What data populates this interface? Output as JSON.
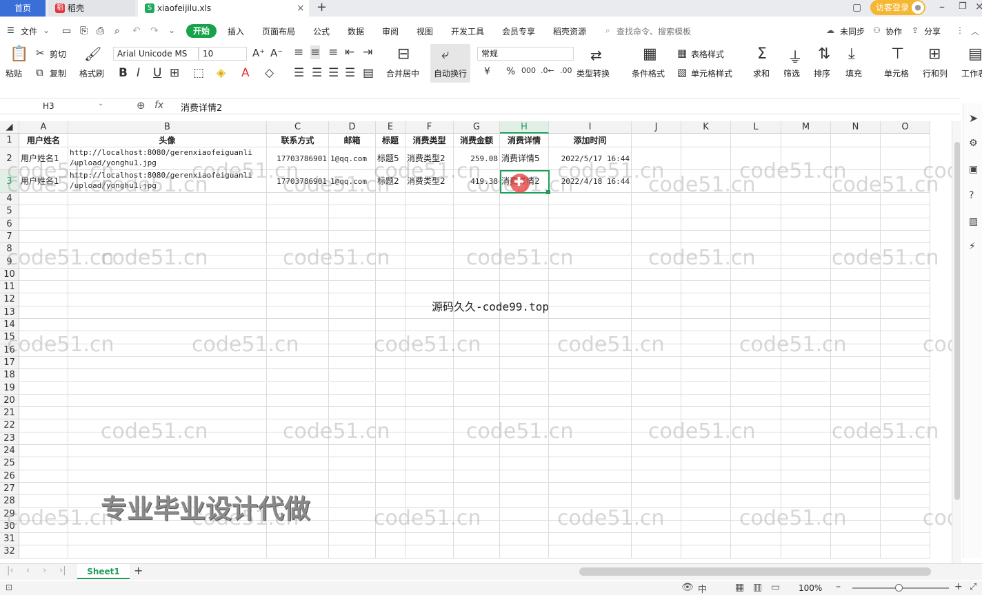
{
  "tabs": {
    "home": "首页",
    "docer": "稻壳",
    "file": "xiaofeijilu.xls"
  },
  "window": {
    "login": "访客登录"
  },
  "menu": {
    "file": "文件",
    "items": [
      "开始",
      "插入",
      "页面布局",
      "公式",
      "数据",
      "审阅",
      "视图",
      "开发工具",
      "会员专享",
      "稻壳资源"
    ],
    "search_placeholder": "查找命令、搜索模板",
    "sync": "未同步",
    "collab": "协作",
    "share": "分享"
  },
  "ribbon": {
    "paste": "粘贴",
    "cut": "剪切",
    "copy": "复制",
    "format_painter": "格式刷",
    "font_name": "Arial Unicode MS",
    "font_size": "10",
    "merge_center": "合并居中",
    "wrap_text": "自动换行",
    "number_format": "常规",
    "type_convert": "类型转换",
    "cond_format": "条件格式",
    "table_style": "表格样式",
    "cell_style": "单元格样式",
    "sum": "求和",
    "filter": "筛选",
    "sort": "排序",
    "fill": "填充",
    "cells": "单元格",
    "rows_cols": "行和列",
    "worksheet": "工作表"
  },
  "formula": {
    "cell_ref": "H3",
    "fx": "fx",
    "content": "消费详情2"
  },
  "columns": [
    "A",
    "B",
    "C",
    "D",
    "E",
    "F",
    "G",
    "H",
    "I",
    "J",
    "K",
    "L",
    "M",
    "N",
    "O"
  ],
  "rows": [
    "1",
    "2",
    "3",
    "4",
    "5",
    "6",
    "7",
    "8",
    "9",
    "10",
    "11",
    "12",
    "13",
    "14",
    "15",
    "16",
    "17",
    "18",
    "19",
    "20",
    "21",
    "22",
    "23",
    "24",
    "25",
    "26",
    "27",
    "28",
    "29",
    "30",
    "31",
    "32"
  ],
  "table": {
    "headers": [
      "用户姓名",
      "头像",
      "联系方式",
      "邮箱",
      "标题",
      "消费类型",
      "消费金额",
      "消费详情",
      "添加时间"
    ],
    "rows": [
      [
        "用户姓名1",
        "http://localhost:8080/gerenxiaofeiguanli",
        "/upload/yonghu1.jpg",
        "17703786901",
        "1@qq.com",
        "标题5",
        "消费类型2",
        "259.08",
        "消费详情5",
        "2022/5/17 16:44"
      ],
      [
        "用户姓名1",
        "http://localhost:8080/gerenxiaofeiguanli",
        "/upload/yonghu1.jpg",
        "17703786901",
        "1@qq.com",
        "标题2",
        "消费类型2",
        "419.38",
        "消费详情2",
        "2022/4/18 16:44"
      ]
    ]
  },
  "overlay": {
    "center_text": "源码久久-code99.top",
    "promo": "专业毕业设计代做",
    "watermark": "code51.cn"
  },
  "sheet": {
    "name": "Sheet1",
    "add": "+"
  },
  "status": {
    "zoom": "100%"
  },
  "colors": {
    "accent": "#16a34a",
    "selection": "#1e9e5a",
    "home_tab": "#3a6fd8"
  }
}
